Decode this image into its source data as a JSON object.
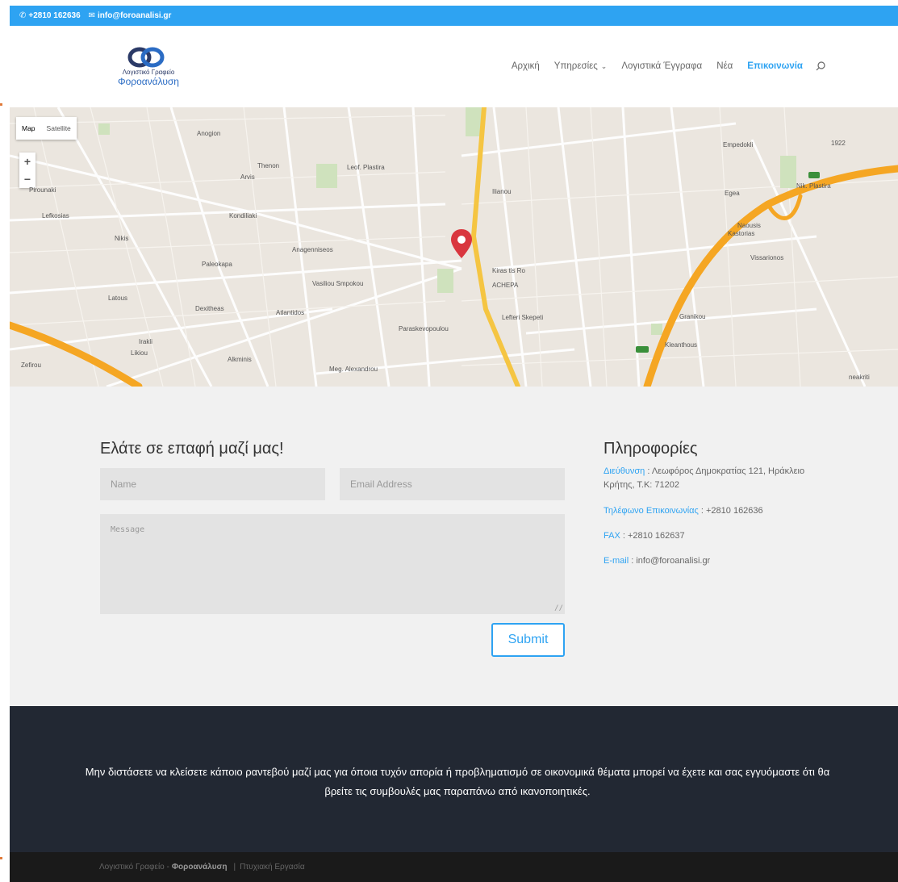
{
  "topbar": {
    "phone": "+2810 162636",
    "email": "info@foroanalisi.gr",
    "phone_icon": "phone-icon",
    "email_icon": "envelope-icon"
  },
  "logo": {
    "line1": "Λογιστικό Γραφείο",
    "line2": "Φοροανάλυση"
  },
  "nav": {
    "items": [
      {
        "label": "Αρχική"
      },
      {
        "label": "Υπηρεσίες"
      },
      {
        "label": "Λογιστικά Έγγραφα"
      },
      {
        "label": "Νέα"
      },
      {
        "label": "Επικοινωνία"
      }
    ],
    "active": "Επικοινωνία",
    "search_icon": "search-icon"
  },
  "map": {
    "type_map": "Map",
    "type_satellite": "Satellite",
    "zoom_in": "+",
    "zoom_out": "−",
    "labels": [
      "Anogion",
      "Thenon",
      "Leof. Plastira",
      "Arvis",
      "Kondiliaki",
      "Anagenniseos",
      "Paleokapa",
      "Vasiliou Smpokou",
      "Dexitheas",
      "Atlantidos",
      "Lefkosias",
      "Pirounaki",
      "Nikis",
      "Latous",
      "Irakli",
      "Likiou",
      "Alkminis",
      "Paraskevopoulou",
      "Kiras tis Ro",
      "ACHEPA",
      "Lefteri Skepeti",
      "Nik. Plastira",
      "Egea",
      "Naousis",
      "Vissarionos",
      "Granikou",
      "Kleanthous",
      "Meg. Alexandrou",
      "Zefirou",
      "Ilianou",
      "neakriti",
      "1922",
      "Empedokli",
      "Kastorias"
    ],
    "road_badges": [
      "90",
      "E75"
    ]
  },
  "contact": {
    "title": "Ελάτε σε επαφή μαζί μας!",
    "name_placeholder": "Name",
    "email_placeholder": "Email Address",
    "message_placeholder": "Message",
    "submit_label": "Submit"
  },
  "info": {
    "title": "Πληροφορίες",
    "address_label": "Διεύθυνση",
    "address_value": " : Λεωφόρος Δημοκρατίας 121, Ηράκλειο Κρήτης, Τ.Κ: 71202",
    "phone_label": "Τηλέφωνο Επικοινωνίας",
    "phone_value": " : +2810 162636",
    "fax_label": "FAX",
    "fax_value": " : +2810 162637",
    "email_label": "E-mail",
    "email_value": " : info@foroanalisi.gr"
  },
  "cta": {
    "text": "Μην διστάσετε να κλείσετε κάποιο ραντεβού μαζί μας για όποια τυχόν απορία ή προβληματισμό σε οικονομικά θέματα μπορεί να έχετε και σας εγγυόμαστε ότι θα βρείτε τις συμβουλές μας παραπάνω από ικανοποιητικές."
  },
  "footer": {
    "prefix": "Λογιστικό Γραφείο -",
    "brand": "Φοροανάλυση",
    "separator": "|",
    "suffix": "Πτυχιακή Εργασία"
  },
  "colors": {
    "accent": "#2ea3f2",
    "dark": "#222833",
    "footer": "#1a1a1a",
    "section_bg": "#f1f1f1",
    "highway": "#f5a623"
  }
}
